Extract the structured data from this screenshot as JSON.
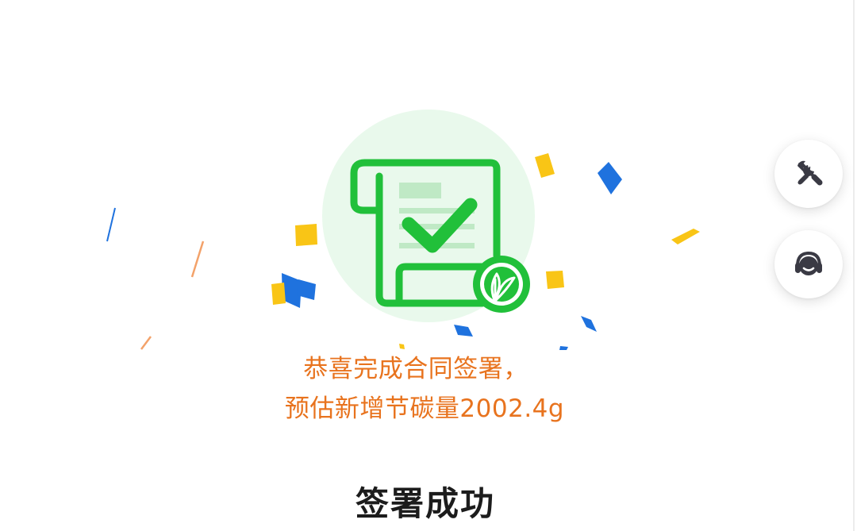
{
  "result": {
    "message_line1": "恭喜完成合同签署，",
    "message_line2": "预估新增节碳量2002.4g",
    "title": "签署成功"
  },
  "icons": {
    "main": "contract-signed-icon",
    "badge": "leaf-icon",
    "tools": "tools-icon",
    "service": "customer-service-icon"
  },
  "colors": {
    "brand_green": "#21c03a",
    "message_orange": "#e8731e",
    "title_text": "#1c1c1c",
    "confetti_blue": "#1f72de",
    "confetti_yellow": "#f9c516",
    "halo": "#e9f9ec"
  }
}
